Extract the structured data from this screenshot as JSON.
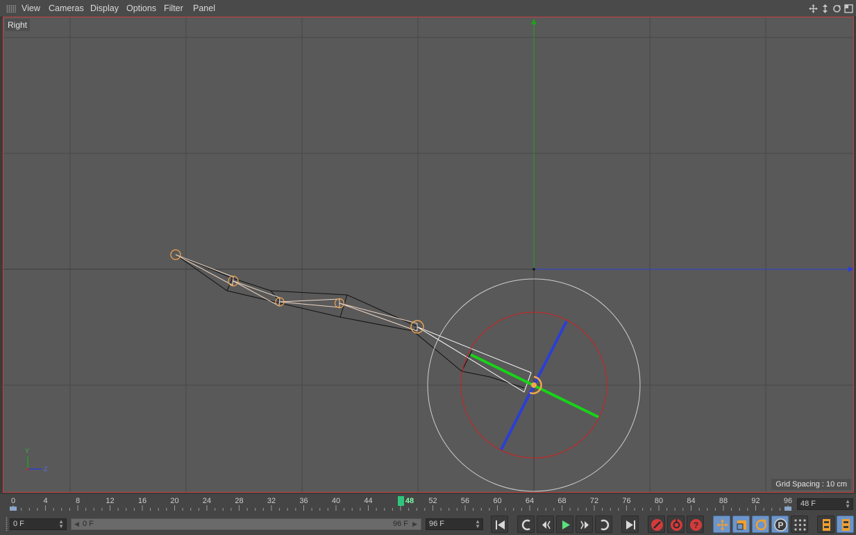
{
  "menu": {
    "items": [
      "View",
      "Cameras",
      "Display",
      "Options",
      "Filter",
      "Panel"
    ]
  },
  "viewport": {
    "label": "Right",
    "grid_spacing": "Grid Spacing : 10 cm",
    "axis_y": "Y",
    "axis_z": "Z"
  },
  "timeline": {
    "ticks": [
      "0",
      "4",
      "8",
      "12",
      "16",
      "20",
      "24",
      "28",
      "32",
      "36",
      "40",
      "44",
      "48",
      "52",
      "56",
      "60",
      "64",
      "68",
      "72",
      "76",
      "80",
      "84",
      "88",
      "92",
      "96"
    ],
    "current_frame_label": "48",
    "current_frame": 48,
    "max_frame": 96,
    "frame_field": "48 F"
  },
  "bottom": {
    "start_field": "0 F",
    "range_start": "0 F",
    "range_end": "96 F",
    "end_field": "96 F"
  },
  "colors": {
    "menubar": "#4a4a4a",
    "viewport_bg": "#595959",
    "grid": "#474747",
    "axis_y": "#1fa21f",
    "axis_z": "#2b3fd6",
    "bone_highlight": "#f2a64f",
    "accent": "#6d95c9"
  },
  "icons": [
    "move-view-icon",
    "zoom-view-icon",
    "rotate-view-icon",
    "maximize-view-icon",
    "go-to-start-icon",
    "previous-key-icon",
    "previous-frame-icon",
    "play-icon",
    "next-frame-icon",
    "next-key-icon",
    "go-to-end-icon",
    "record-icon",
    "autokey-icon",
    "keyframe-selection-icon",
    "move-icon",
    "scale-icon",
    "rotate-icon",
    "param-icon",
    "pla-icon",
    "timeline-icon",
    "scheme-icon"
  ]
}
